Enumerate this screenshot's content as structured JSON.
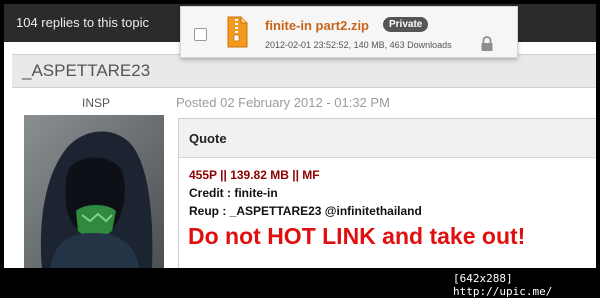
{
  "topic": {
    "replies_text": "104 replies to this topic"
  },
  "attachment": {
    "filename": "finite-in part2.zip",
    "badge": "Private",
    "meta": "2012-02-01 23:52:52, 140 MB, 463 Downloads",
    "icon": "zip-file-icon"
  },
  "post": {
    "username": "_ASPETTARE23",
    "role": "INSP",
    "posted": "Posted 02 February 2012 - 01:32 PM"
  },
  "quote": {
    "title": "Quote",
    "stats": "455P || 139.82 MB || MF",
    "credit": "Credit : finite-in",
    "reup": "Reup : _ASPETTARE23 @infinitethailand",
    "warning": "Do not HOT LINK and take out!"
  },
  "footer": {
    "text": "[642x288] http://upic.me/"
  },
  "colors": {
    "topbar": "#2b2b2b",
    "filename": "#c7641a",
    "stats": "#8b0000",
    "warning": "#e01010",
    "username_bar": "#e9e9e9"
  }
}
